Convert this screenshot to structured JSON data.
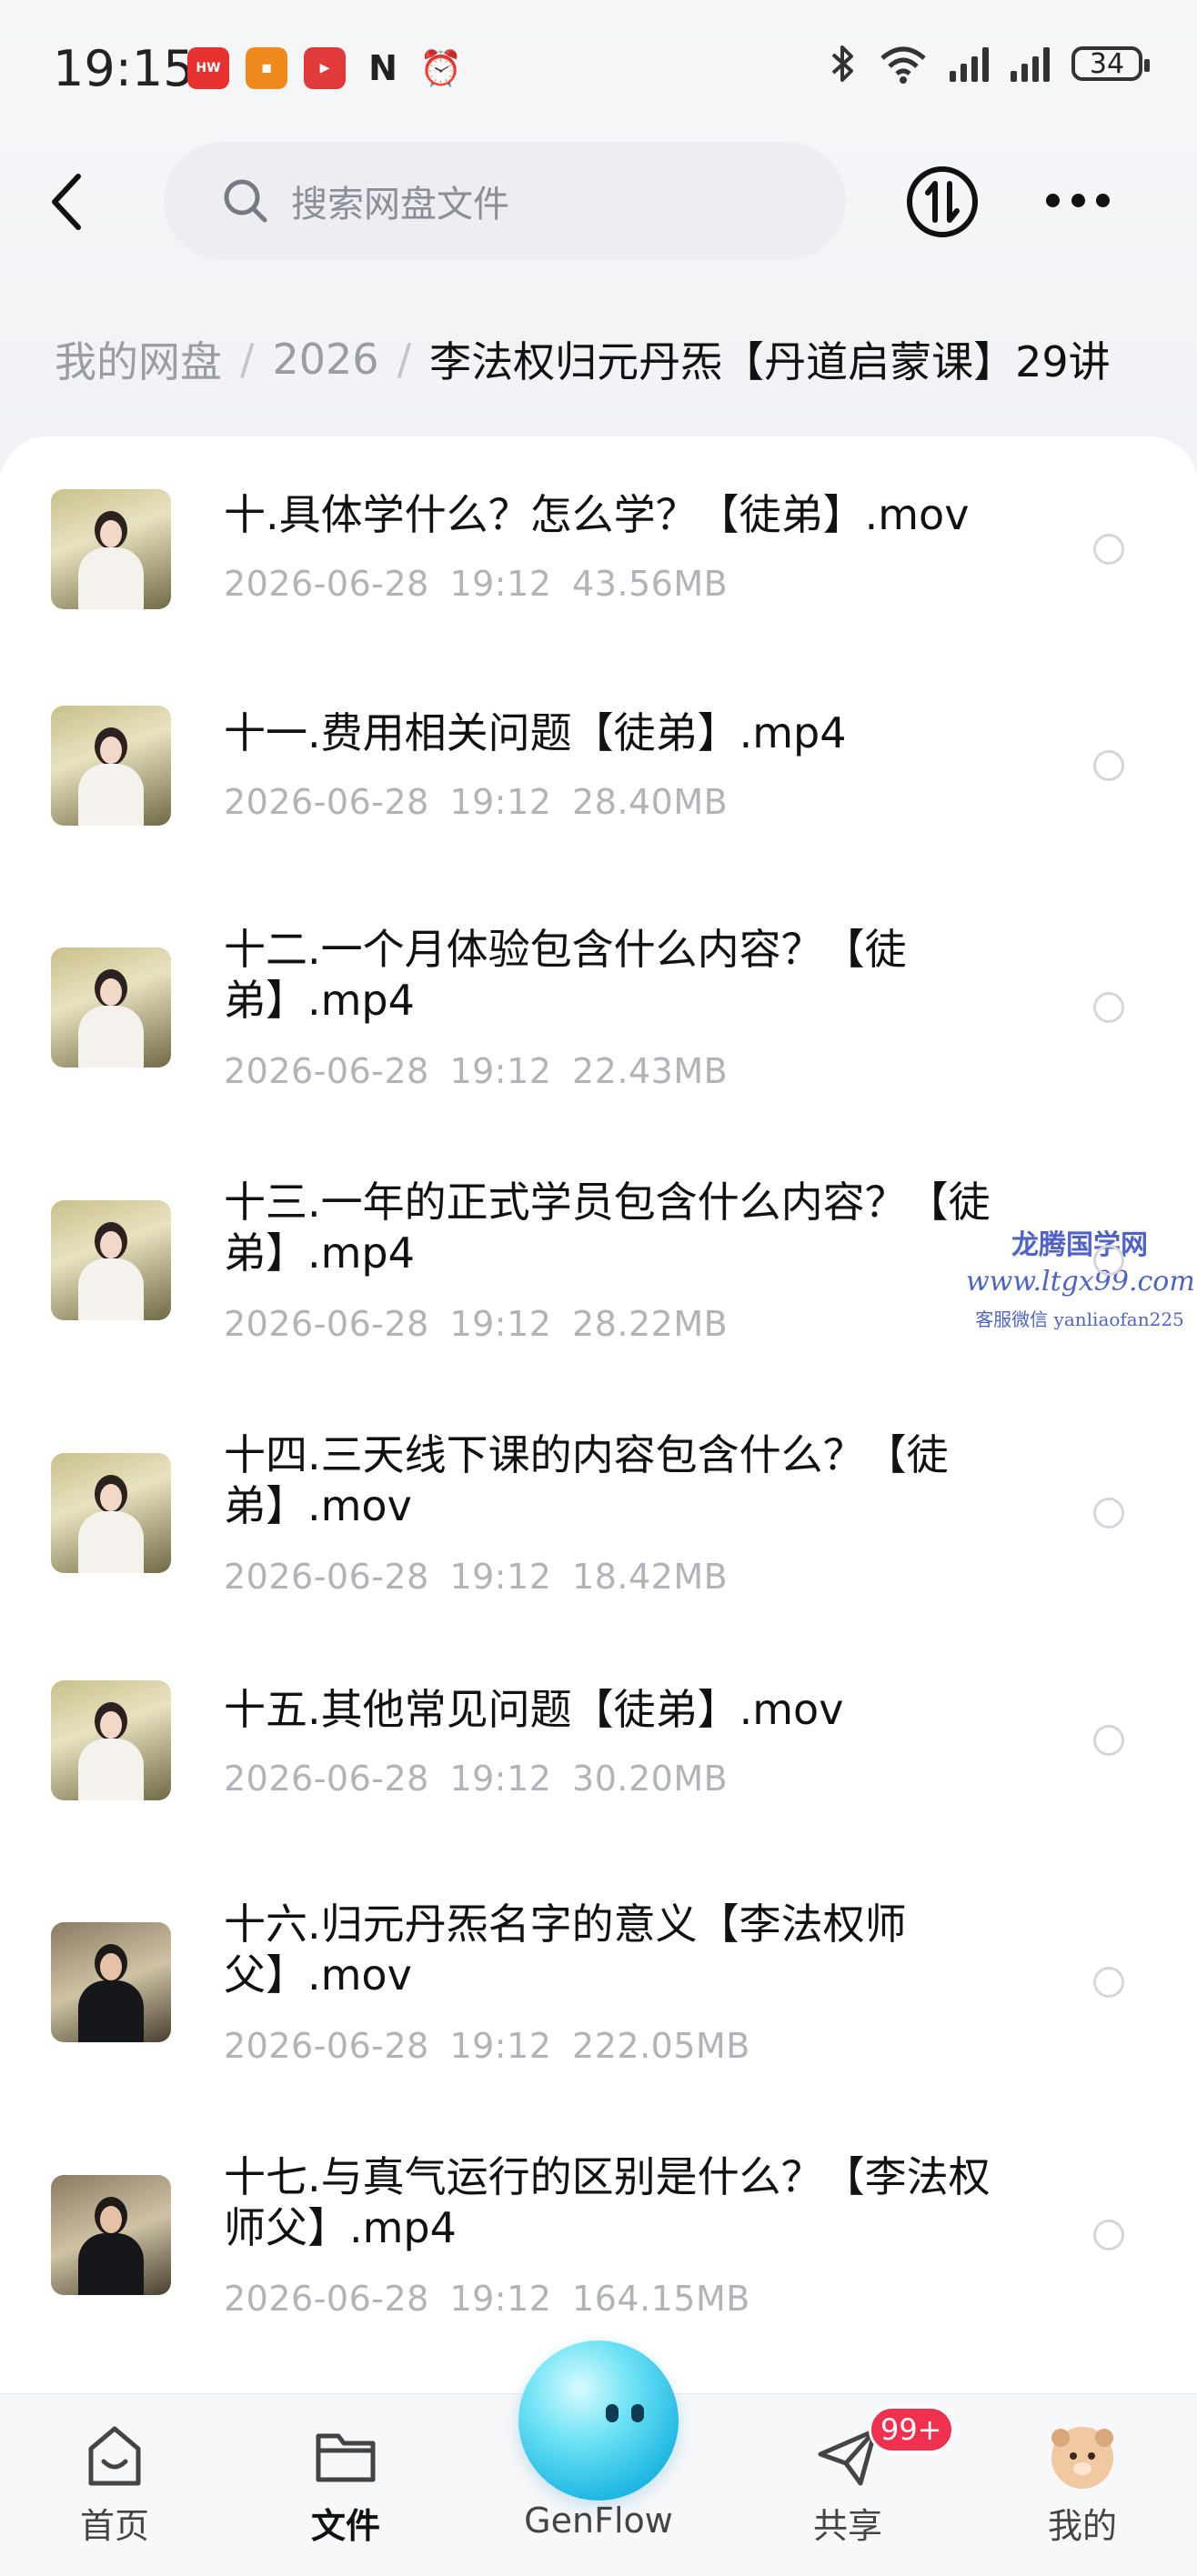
{
  "status_bar": {
    "time": "19:15",
    "battery": "34",
    "icons": [
      "huawei-app-icon",
      "wallet-icon",
      "video-app-icon",
      "nfc-icon",
      "alarm-icon",
      "bluetooth-icon",
      "wifi-icon",
      "signal-icon",
      "signal-icon"
    ]
  },
  "header": {
    "search_placeholder": "搜索网盘文件",
    "transfer_icon": "transfer-icon",
    "more_icon": "more-icon"
  },
  "breadcrumb": {
    "items": [
      "我的网盘",
      "2026"
    ],
    "current": "李法权归元丹炁【丹道启蒙课】29讲"
  },
  "files": [
    {
      "name": "十.具体学什么？怎么学？【徒弟】.mov",
      "date": "2026-06-28",
      "time": "19:12",
      "size": "43.56MB"
    },
    {
      "name": "十一.费用相关问题【徒弟】.mp4",
      "date": "2026-06-28",
      "time": "19:12",
      "size": "28.40MB"
    },
    {
      "name": "十二.一个月体验包含什么内容？【徒弟】.mp4",
      "date": "2026-06-28",
      "time": "19:12",
      "size": "22.43MB"
    },
    {
      "name": "十三.一年的正式学员包含什么内容？【徒弟】.mp4",
      "date": "2026-06-28",
      "time": "19:12",
      "size": "28.22MB"
    },
    {
      "name": "十四.三天线下课的内容包含什么？【徒弟】.mov",
      "date": "2026-06-28",
      "time": "19:12",
      "size": "18.42MB"
    },
    {
      "name": "十五.其他常见问题【徒弟】.mov",
      "date": "2026-06-28",
      "time": "19:12",
      "size": "30.20MB"
    },
    {
      "name": "十六.归元丹炁名字的意义【李法权师父】.mov",
      "date": "2026-06-28",
      "time": "19:12",
      "size": "222.05MB"
    },
    {
      "name": "十七.与真气运行的区别是什么？【李法权师父】.mp4",
      "date": "2026-06-28",
      "time": "19:12",
      "size": "164.15MB"
    }
  ],
  "watermark": {
    "line1": "龙腾国学网",
    "line2": "www.ltgx99.com",
    "line3": "客服微信 yanliaofan225"
  },
  "nav": {
    "home": "首页",
    "files": "文件",
    "genflow": "GenFlow",
    "share": "共享",
    "share_badge": "99+",
    "mine": "我的"
  },
  "colors": {
    "badge": "#f0304f",
    "genflow": "#1fb7e3",
    "watermark": "#4f63c7"
  }
}
